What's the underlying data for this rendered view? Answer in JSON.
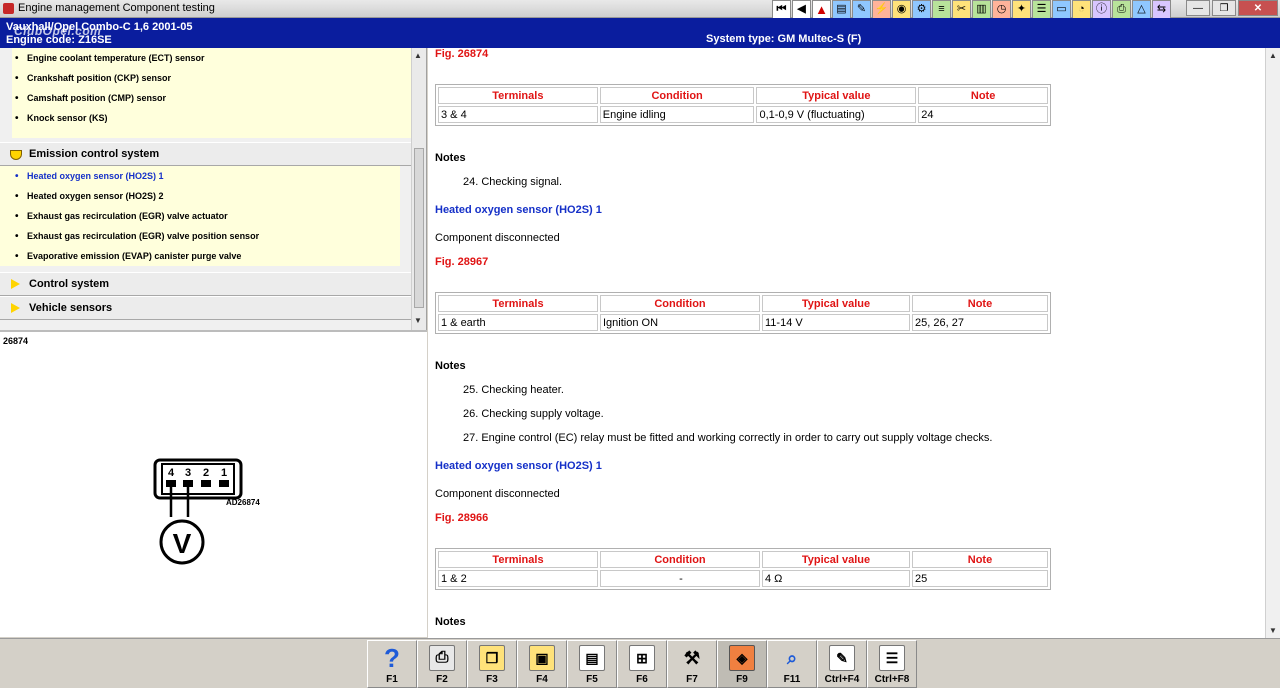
{
  "window": {
    "title": "Engine management Component testing"
  },
  "toolbar": {
    "icons": [
      "first-icon",
      "prev-icon",
      "warning-icon",
      "document-icon",
      "settings-icon",
      "wiring-icon",
      "sensor-icon",
      "gear-icon",
      "chart-icon",
      "tools-icon",
      "fuel-icon",
      "clock-icon",
      "component-icon",
      "list-icon",
      "battery-icon",
      "meter-icon",
      "info-icon",
      "printer-icon",
      "lamp-icon",
      "link-icon"
    ]
  },
  "header": {
    "vehicle": "Vauxhall/Opel   Combo-C  1,6  2001-05",
    "engine": "Engine code: Z16SE",
    "watermark": "ClubOpel.com",
    "system_type": "System type: GM Multec-S (F)"
  },
  "tree": {
    "engine_items": [
      {
        "label": "Engine coolant temperature (ECT) sensor"
      },
      {
        "label": "Crankshaft position (CKP) sensor"
      },
      {
        "label": "Camshaft position (CMP) sensor"
      },
      {
        "label": "Knock sensor (KS)"
      }
    ],
    "emission_group": "Emission control system",
    "emission_items": [
      {
        "label": "Heated oxygen sensor (HO2S) 1",
        "selected": true
      },
      {
        "label": "Heated oxygen sensor (HO2S) 2"
      },
      {
        "label": "Exhaust gas recirculation (EGR) valve actuator"
      },
      {
        "label": "Exhaust gas recirculation (EGR) valve position sensor"
      },
      {
        "label": "Evaporative emission (EVAP) canister purge valve"
      }
    ],
    "control_group": "Control system",
    "vehicle_group": "Vehicle sensors"
  },
  "figure": {
    "id": "26874",
    "connector_pins": [
      "4",
      "3",
      "2",
      "1"
    ],
    "drawing_label": "AD26874",
    "meter_symbol": "V"
  },
  "content": {
    "headers": [
      "Terminals",
      "Condition",
      "Typical value",
      "Note"
    ],
    "notes_label": "Notes",
    "block1": {
      "fig": "Fig. 26874",
      "rows": [
        [
          "3 & 4",
          "Engine idling",
          "0,1-0,9 V (fluctuating)",
          "24"
        ]
      ],
      "notes": [
        "24. Checking signal."
      ]
    },
    "block2": {
      "heading": "Heated oxygen sensor (HO2S) 1",
      "state": "Component disconnected",
      "fig": "Fig. 28967",
      "rows": [
        [
          "1 & earth",
          "Ignition ON",
          "11-14 V",
          "25, 26, 27"
        ]
      ],
      "notes": [
        "25. Checking heater.",
        "26. Checking supply voltage.",
        "27. Engine control (EC) relay must be fitted and working correctly in order to carry out supply voltage checks."
      ]
    },
    "block3": {
      "heading": "Heated oxygen sensor (HO2S) 1",
      "state": "Component disconnected",
      "fig": "Fig. 28966",
      "rows": [
        [
          "1 & 2",
          "-",
          "4 Ω",
          "25"
        ]
      ]
    }
  },
  "fnbar": {
    "keys": [
      {
        "label": "F1",
        "icon": "help-icon"
      },
      {
        "label": "F2",
        "icon": "print-icon"
      },
      {
        "label": "F3",
        "icon": "copy-icon"
      },
      {
        "label": "F4",
        "icon": "images-icon"
      },
      {
        "label": "F5",
        "icon": "page-icon"
      },
      {
        "label": "F6",
        "icon": "diagram-icon"
      },
      {
        "label": "F7",
        "icon": "tools-icon"
      },
      {
        "label": "F9",
        "icon": "component-icon"
      },
      {
        "label": "F11",
        "icon": "search-icon"
      },
      {
        "label": "Ctrl+F4",
        "icon": "notes-icon"
      },
      {
        "label": "Ctrl+F8",
        "icon": "list-icon"
      }
    ]
  }
}
